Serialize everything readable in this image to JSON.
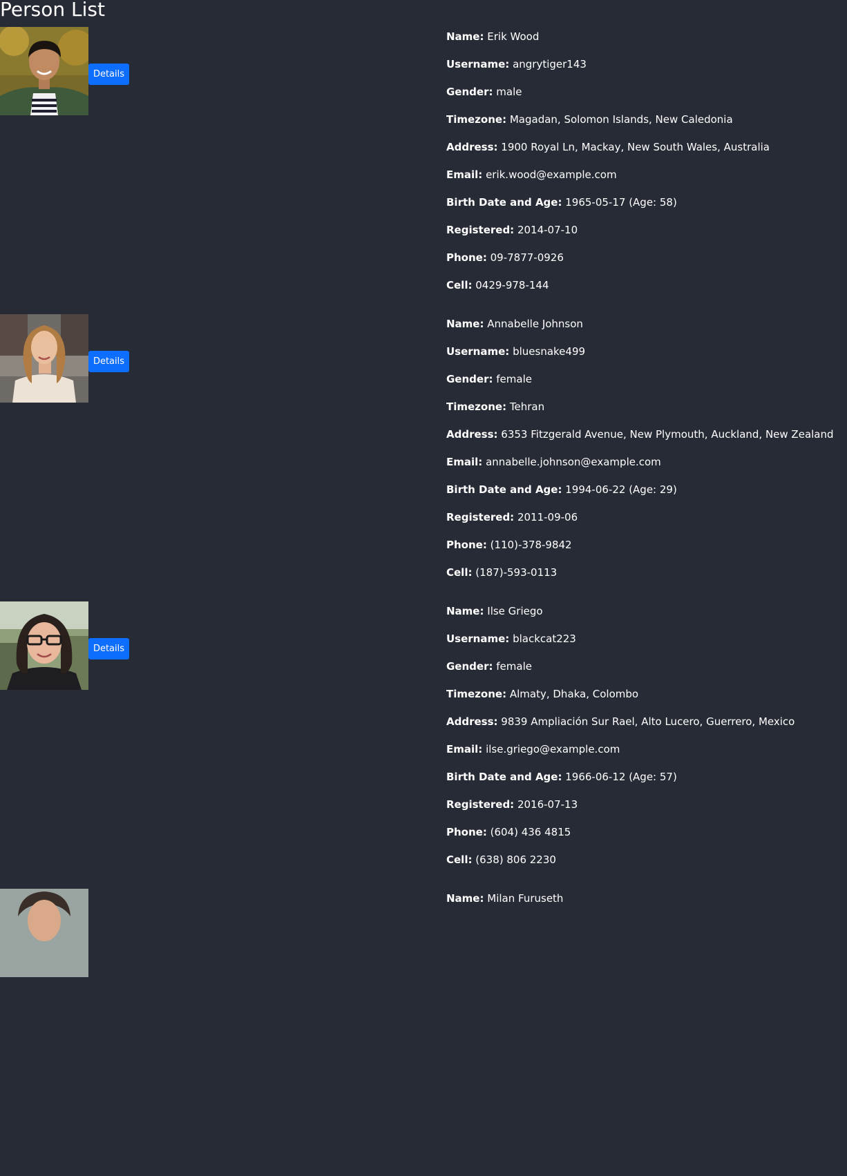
{
  "page": {
    "title": "Person List"
  },
  "field_labels": {
    "name": "Name:",
    "username": "Username:",
    "gender": "Gender:",
    "timezone": "Timezone:",
    "address": "Address:",
    "email": "Email:",
    "birth": "Birth Date and Age:",
    "registered": "Registered:",
    "phone": "Phone:",
    "cell": "Cell:"
  },
  "details_label": "Details",
  "colors": {
    "background": "#272b35",
    "text": "#ffffff",
    "button": "#0d6efd"
  },
  "people": [
    {
      "name": "Erik Wood",
      "username": "angrytiger143",
      "gender": "male",
      "timezone": "Magadan, Solomon Islands, New Caledonia",
      "address": "1900 Royal Ln, Mackay, New South Wales, Australia",
      "email": "erik.wood@example.com",
      "birth": "1965-05-17 (Age: 58)",
      "registered": "2014-07-10",
      "phone": "09-7877-0926",
      "cell": "0429-978-144"
    },
    {
      "name": "Annabelle Johnson",
      "username": "bluesnake499",
      "gender": "female",
      "timezone": "Tehran",
      "address": "6353 Fitzgerald Avenue, New Plymouth, Auckland, New Zealand",
      "email": "annabelle.johnson@example.com",
      "birth": "1994-06-22 (Age: 29)",
      "registered": "2011-09-06",
      "phone": "(110)-378-9842",
      "cell": "(187)-593-0113"
    },
    {
      "name": "Ilse Griego",
      "username": "blackcat223",
      "gender": "female",
      "timezone": "Almaty, Dhaka, Colombo",
      "address": "9839 Ampliación Sur Rael, Alto Lucero, Guerrero, Mexico",
      "email": "ilse.griego@example.com",
      "birth": "1966-06-12 (Age: 57)",
      "registered": "2016-07-13",
      "phone": "(604) 436 4815",
      "cell": "(638) 806 2230"
    },
    {
      "name": "Milan Furuseth"
    }
  ]
}
